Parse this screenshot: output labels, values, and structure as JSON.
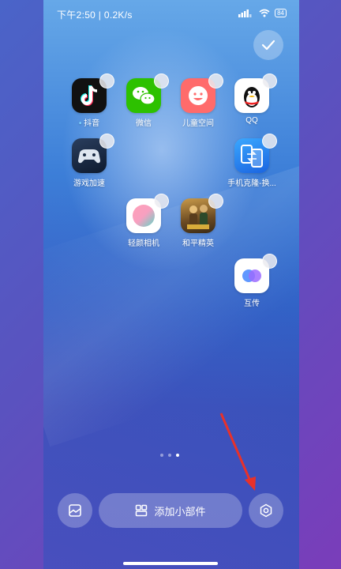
{
  "status": {
    "time": "下午2:50",
    "speed": "0.2K/s",
    "battery": "84"
  },
  "apps": [
    {
      "label": "抖音",
      "icon": "tiktok-icon"
    },
    {
      "label": "微信",
      "icon": "wechat-icon"
    },
    {
      "label": "儿童空间",
      "icon": "kids-space-icon"
    },
    {
      "label": "QQ",
      "icon": "qq-penguin-icon"
    },
    {
      "label": "游戏加速",
      "icon": "gamepad-icon"
    },
    {
      "label": "手机克隆-换...",
      "icon": "phone-clone-icon"
    },
    {
      "label": "轻颜相机",
      "icon": "camera-gradient-icon"
    },
    {
      "label": "和平精英",
      "icon": "game-peace-elite-icon"
    },
    {
      "label": "互传",
      "icon": "share-icon"
    }
  ],
  "page_indicator": {
    "count": 3,
    "active_index": 2
  },
  "bottom_bar": {
    "widget_label": "添加小部件"
  },
  "colors": {
    "annotation_arrow": "#e8312a"
  }
}
